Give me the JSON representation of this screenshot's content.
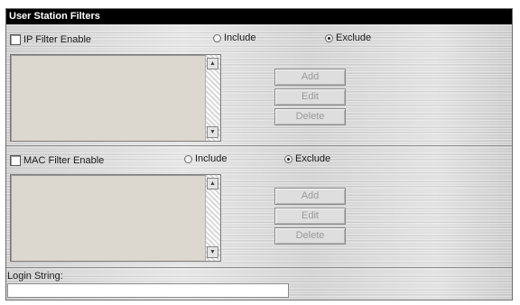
{
  "panel": {
    "title": "User Station Filters"
  },
  "ip_filter": {
    "enable_label": "IP Filter Enable",
    "enabled": false,
    "include_label": "Include",
    "exclude_label": "Exclude",
    "selected_mode": "Exclude",
    "add_label": "Add",
    "edit_label": "Edit",
    "delete_label": "Delete"
  },
  "mac_filter": {
    "enable_label": "MAC Filter Enable",
    "enabled": false,
    "include_label": "Include",
    "exclude_label": "Exclude",
    "selected_mode": "Exclude",
    "add_label": "Add",
    "edit_label": "Edit",
    "delete_label": "Delete"
  },
  "login": {
    "label": "Login String:",
    "value": ""
  },
  "icons": {
    "scroll_up": "arrow-up-icon",
    "scroll_down": "arrow-down-icon"
  },
  "colors": {
    "title_bar": "#000000",
    "title_text": "#ffffff",
    "disabled_text": "#9a9a9a",
    "listbox_bg": "#dcd7cf"
  }
}
